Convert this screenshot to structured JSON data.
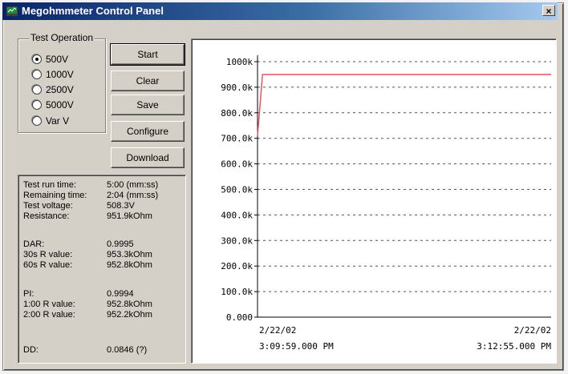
{
  "window": {
    "title": "Megohmmeter Control Panel",
    "close_glyph": "×",
    "icon": "app-icon"
  },
  "test_operation": {
    "label": "Test Operation",
    "options": [
      {
        "label": "500V",
        "selected": true
      },
      {
        "label": "1000V",
        "selected": false
      },
      {
        "label": "2500V",
        "selected": false
      },
      {
        "label": "5000V",
        "selected": false
      },
      {
        "label": "Var V",
        "selected": false
      }
    ]
  },
  "buttons": {
    "start": "Start",
    "clear": "Clear",
    "save": "Save",
    "configure": "Configure",
    "download": "Download"
  },
  "info": {
    "test_run_time": {
      "label": "Test run time:",
      "value": "5:00 (mm:ss)"
    },
    "remaining_time": {
      "label": "Remaining time:",
      "value": "2:04 (mm:ss)"
    },
    "test_voltage": {
      "label": "Test voltage:",
      "value": "508.3V"
    },
    "resistance": {
      "label": "Resistance:",
      "value": "951.9kOhm"
    },
    "dar": {
      "label": "DAR:",
      "value": "0.9995"
    },
    "r30": {
      "label": "30s R value:",
      "value": "953.3kOhm"
    },
    "r60": {
      "label": "60s R value:",
      "value": "952.8kOhm"
    },
    "pi": {
      "label": "PI:",
      "value": "0.9994"
    },
    "r100": {
      "label": "1:00 R value:",
      "value": "952.8kOhm"
    },
    "r200": {
      "label": "2:00 R value:",
      "value": "952.2kOhm"
    },
    "dd": {
      "label": "DD:",
      "value": "0.0846 (?)"
    }
  },
  "chart_data": {
    "type": "line",
    "y_tick_labels": [
      "0.000",
      "100.0k",
      "200.0k",
      "300.0k",
      "400.0k",
      "500.0k",
      "600.0k",
      "700.0k",
      "800.0k",
      "900.0k",
      "1000k"
    ],
    "ylim": [
      0,
      1000000
    ],
    "xlim": [
      "2/22/02 3:09:59.000 PM",
      "2/22/02 3:12:55.000 PM"
    ],
    "x_start": {
      "date": "2/22/02",
      "time": "3:09:59.000 PM"
    },
    "x_end": {
      "date": "2/22/02",
      "time": "3:12:55.000 PM"
    },
    "grid": "horizontal dashed",
    "series": [
      {
        "color": "#e8545e",
        "points": [
          {
            "x": "3:09:59 PM",
            "y": 710000
          },
          {
            "x": "3:10:02 PM",
            "y": 950000
          },
          {
            "x": "3:12:55 PM",
            "y": 950000
          }
        ]
      }
    ]
  }
}
